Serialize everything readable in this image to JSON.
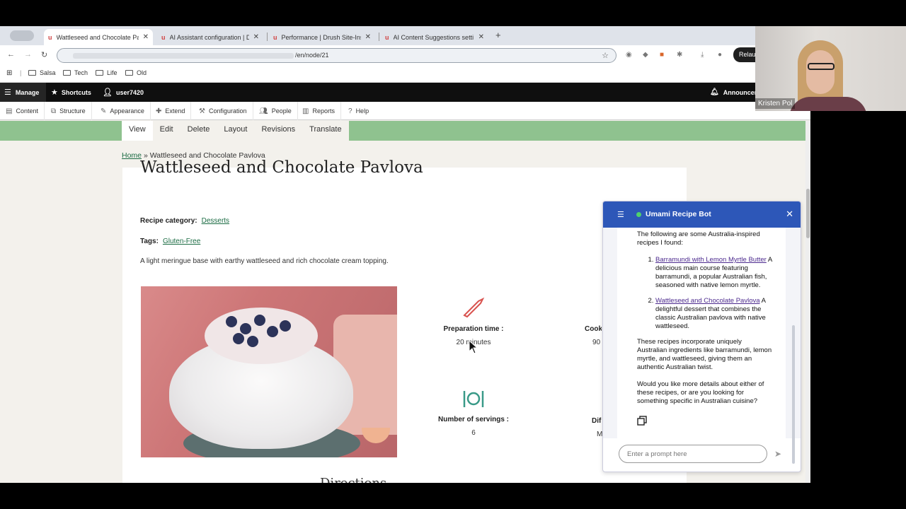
{
  "tabs": [
    {
      "title": "Wattleseed and Chocolate Pavlova",
      "fav": "u"
    },
    {
      "title": "AI Assistant configuration | D",
      "fav": "u"
    },
    {
      "title": "Performance | Drush Site-Inst",
      "fav": "u"
    },
    {
      "title": "AI Content Suggestions setti",
      "fav": "u"
    }
  ],
  "omnibox": {
    "url_suffix": "/en/node/21"
  },
  "browser_actions": {
    "relaunch": "Relaunch"
  },
  "bookmarks": [
    "Salsa",
    "Tech",
    "Life",
    "Old"
  ],
  "admin_toolbar": {
    "manage": "Manage",
    "shortcuts": "Shortcuts",
    "user": "user7420",
    "announcements": "Announcem"
  },
  "admin_tray": [
    "Content",
    "Structure",
    "Appearance",
    "Extend",
    "Configuration",
    "People",
    "Reports",
    "Help"
  ],
  "local_tasks": [
    "View",
    "Edit",
    "Delete",
    "Layout",
    "Revisions",
    "Translate"
  ],
  "breadcrumb": {
    "home": "Home",
    "separator": "»",
    "current": "Wattleseed and Chocolate Pavlova"
  },
  "recipe": {
    "title": "Wattleseed and Chocolate Pavlova",
    "category_label": "Recipe category:",
    "category": "Desserts",
    "tags_label": "Tags:",
    "tag": "Gluten-Free",
    "summary": "A light meringue base with earthy wattleseed and rich chocolate cream topping.",
    "facts": [
      {
        "label": "Preparation time :",
        "value": "20 minutes"
      },
      {
        "label": "Cook",
        "value": "90"
      },
      {
        "label": "Number of servings :",
        "value": "6"
      },
      {
        "label": "Dif",
        "value": "M"
      }
    ],
    "directions_heading": "Directions"
  },
  "chatbot": {
    "title": "Umami Recipe Bot",
    "intro": "The following are some Australia-inspired recipes I found:",
    "results": [
      {
        "link": "Barramundi with Lemon Myrtle Butter",
        "desc": " A delicious main course featuring barramundi, a popular Australian fish, seasoned with native lemon myrtle."
      },
      {
        "link": "Wattleseed and Chocolate Pavlova",
        "desc": " A delightful dessert that combines the classic Australian pavlova with native wattleseed."
      }
    ],
    "para2": "These recipes incorporate uniquely Australian ingredients like barramundi, lemon myrtle, and wattleseed, giving them an authentic Australian twist.",
    "para3": "Would you like more details about either of these recipes, or are you looking for something specific in Australian cuisine?",
    "input_placeholder": "Enter a prompt here"
  },
  "webcam": {
    "name": "Kristen Pol"
  },
  "colors": {
    "chat_header": "#2d57b8",
    "local_tasks_bar": "#8fc28f",
    "link_green": "#1c6c44",
    "admin_bar": "#0f0f0f"
  }
}
